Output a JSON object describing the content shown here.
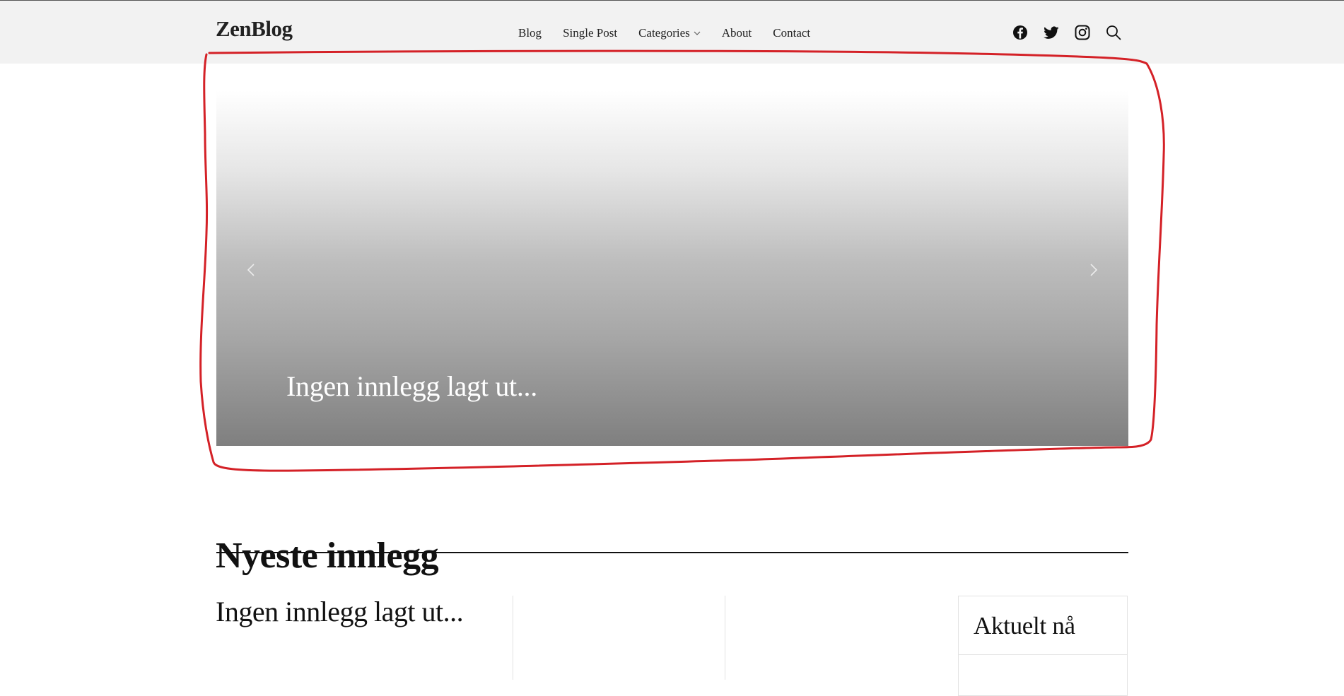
{
  "header": {
    "logo": "ZenBlog",
    "nav": [
      {
        "label": "Blog"
      },
      {
        "label": "Single Post"
      },
      {
        "label": "Categories",
        "has_dropdown": true
      },
      {
        "label": "About"
      },
      {
        "label": "Contact"
      }
    ],
    "social_icons": [
      "facebook-icon",
      "twitter-icon",
      "instagram-icon",
      "search-icon"
    ]
  },
  "slider": {
    "caption": "Ingen innlegg lagt ut...",
    "prev_icon": "chevron-left-icon",
    "next_icon": "chevron-right-icon"
  },
  "latest": {
    "title": "Nyeste innlegg",
    "post_title": "Ingen innlegg lagt ut..."
  },
  "sidebar": {
    "title": "Aktuelt nå"
  },
  "colors": {
    "header_bg": "#f2f2f2",
    "annotation": "#d42127",
    "text": "#111111"
  }
}
